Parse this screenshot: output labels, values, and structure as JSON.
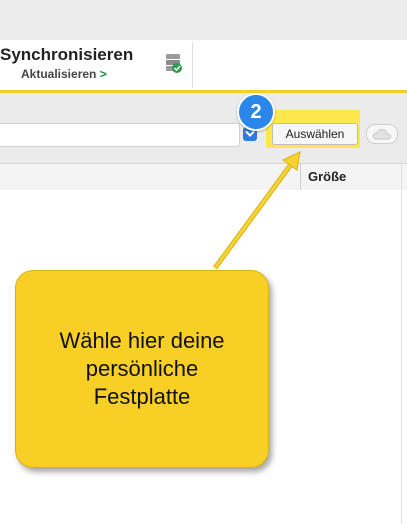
{
  "ribbon": {
    "sync_title": "Synchronisieren",
    "refresh_label": "Aktualisieren",
    "refresh_chevron": ">",
    "sync_icon": "database-sync-icon"
  },
  "toolbar": {
    "step_badge": "2",
    "choose_label": "Auswählen",
    "dropdown_icon": "chevron-down-icon",
    "cloud_icon": "cloud-icon"
  },
  "table": {
    "columns": [
      "Größe"
    ]
  },
  "callout": {
    "text": "Wähle hier deine\npersönliche\nFestplatte"
  },
  "colors": {
    "highlight": "#f7cf25",
    "badge": "#2a86e8",
    "accent_line": "#f2d21b"
  }
}
